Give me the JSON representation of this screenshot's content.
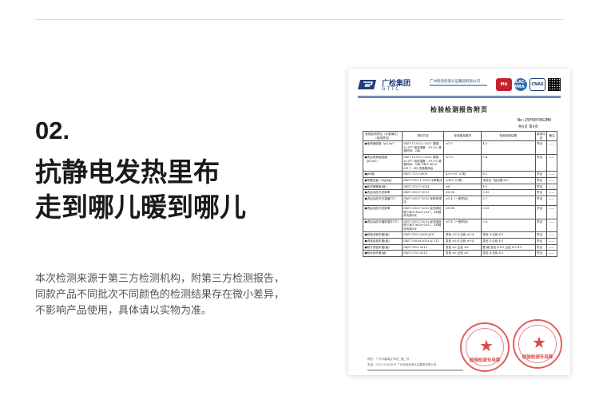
{
  "section": {
    "number": "02.",
    "headline": [
      "抗静电发热里布",
      "走到哪儿暖到哪儿"
    ],
    "body": [
      "本次检测来源于第三方检测机构，附第三方检测报告，",
      "同款产品不同批次不同颜色的检测结果存在微小差异，",
      "不影响产品使用，具体请以实物为准。"
    ]
  },
  "report": {
    "org_name": "广检集团",
    "org_abbr": "GTTC",
    "org_full": "广州检验检测认证集团有限公司",
    "marks": {
      "ma": "MA",
      "ilac": "ILAC-MRA",
      "cnas": "CNAS"
    },
    "title": "检验检测报告附页",
    "report_no": "No:25F007062M0",
    "page_no": "共6页 第4页",
    "headers": [
      "检验检测项目（计量单位）（检测项目）",
      "测试方法",
      "标准值及要求",
      "检验检测结果",
      "单项评定",
      "备注"
    ],
    "rows": [
      [
        "●电荷面密度（μC/m²）",
        "GB/T 12703.2-2021 调湿：20.0℃ 相对湿度：39.2% 调湿时间：24h",
        "≤7.0",
        "4.3",
        "符合",
        "——"
      ],
      [
        "●洗后电荷面密度（μC/m²）",
        "GB/T 12703.2-2021 调湿：20.0℃ 相对湿度：39.2% 调湿时间：24h GB/T 8629-2017，4N 洗涤程序后",
        "≤7.0",
        "3.4",
        "符合",
        "——"
      ],
      [
        "●pH值",
        "GB/T 7573-2009",
        "4.0~9.0（C类）",
        "6.2",
        "符合",
        "——"
      ],
      [
        "●甲醛含量（mg/kg）",
        "GB/T 2912.1-2009 水萃取法",
        "≤300（C类）",
        "未检出（检出限:20）",
        "符合",
        "——"
      ],
      [
        "●色牢度等级(级)",
        "GB/T 31127-2014",
        "≥4",
        "4-5",
        "符合",
        "——"
      ],
      [
        "●洗后远红外发射率",
        "GB/T 30127-2013",
        "≥0.88",
        "0.93",
        "符合",
        "——"
      ],
      [
        "●洗后远红外升温值(℃)",
        "GB/T 30127-2013 采样处理法",
        "≥1.4（一般样品）",
        "2.7",
        "符合",
        "——"
      ],
      [
        "●洗后远红外发射率",
        "GB/T 30127-2013 经洗涤处理 GB/T 8629-2017，4N程序洗涤5次",
        "≥0.88",
        "0.93",
        "符合",
        "——"
      ],
      [
        "●洗后远红外辐射温升(℃)",
        "GB/T 30127-2013 经洗涤处理 GB/T 8629-2017，4N程序洗涤5次",
        "≥1.4（一般样品）",
        "2.6",
        "符合",
        "——"
      ],
      [
        "●耐皂洗色牢度(级)",
        "GB/T 3921-2008 A(1)",
        "变色 ≥3-4 沾色 ≥3-4",
        "变色 4 沾色 4-5",
        "符合",
        "——"
      ],
      [
        "●洗涤后色牢度(级)",
        "GB/T 23038-2019 A.1.11",
        "变色 ≥3-4 沾色 ≥3-4",
        "变色 4 沾色 4-5",
        "符合",
        "——"
      ],
      [
        "●耐汗渍色牢度(级)",
        "GB/T 3922-2013",
        "变色 ≥3 沾色 ≥3",
        "酸 碱 变色 4 4-5 沾色 4-5 4-5",
        "符合",
        "——"
      ],
      [
        "●耐水色牢度(级)",
        "GB/T 5713-2013",
        "变色 ≥3 沾色 ≥3",
        "变色 4 沾色 4-5",
        "符合",
        "——"
      ]
    ],
    "stamp_text": "检验检测专用章",
    "footer": [
      "报告：广州市番禺区市场二路二号",
      "电话：020-12345678  广州检验检测认证集团有限公司"
    ]
  }
}
